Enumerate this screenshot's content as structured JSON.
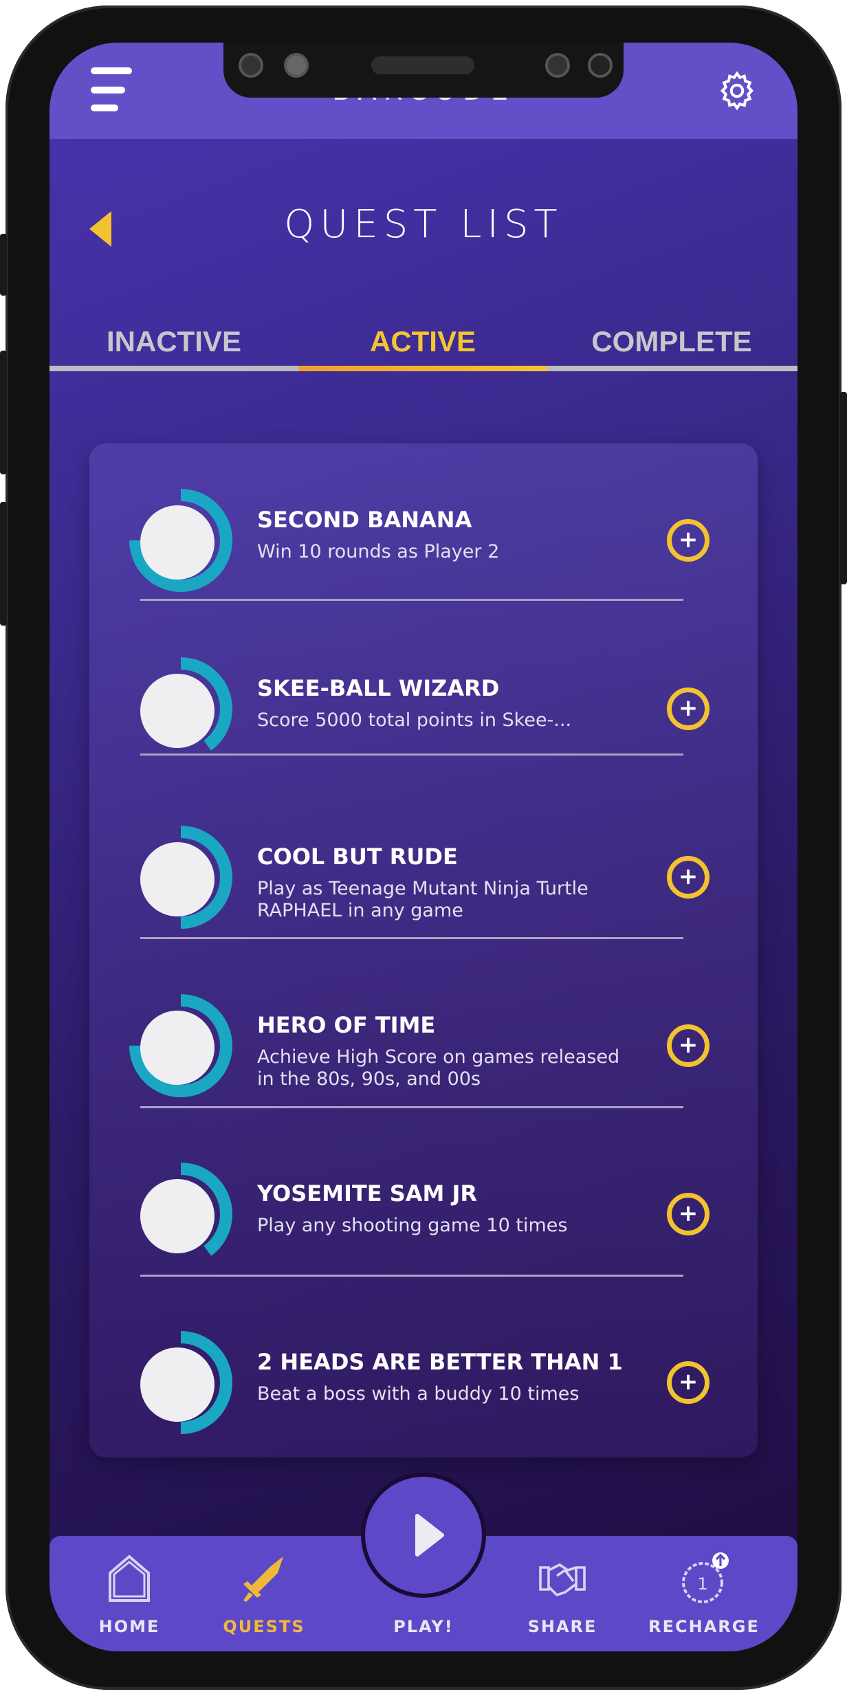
{
  "header": {
    "logo_text": "BARCODE",
    "menu_icon": "hamburger-icon",
    "settings_icon": "gear-icon"
  },
  "page": {
    "title": "QUEST LIST",
    "back_icon": "back-arrow-icon"
  },
  "tabs": [
    {
      "label": "INACTIVE",
      "active": false
    },
    {
      "label": "ACTIVE",
      "active": true
    },
    {
      "label": "COMPLETE",
      "active": false
    }
  ],
  "quests": [
    {
      "title": "SECOND BANANA",
      "description": "Win 10 rounds as Player 2",
      "progress": 0.75
    },
    {
      "title": "SKEE-BALL WIZARD",
      "description": "Score 5000 total points in Skee-...",
      "progress": 0.4
    },
    {
      "title": "COOL BUT RUDE",
      "description": "Play as Teenage Mutant Ninja Turtle RAPHAEL in any game",
      "progress": 0.5
    },
    {
      "title": "HERO OF TIME",
      "description": "Achieve High Score on games released in the 80s, 90s, and 00s",
      "progress": 0.75
    },
    {
      "title": "YOSEMITE SAM JR",
      "description": "Play any shooting game 10 times",
      "progress": 0.4
    },
    {
      "title": "2 HEADS ARE BETTER THAN 1",
      "description": "Beat a boss with a buddy 10 times",
      "progress": 0.5
    }
  ],
  "add_symbol": "+",
  "nav": [
    {
      "label": "HOME",
      "icon": "home-icon",
      "active": false
    },
    {
      "label": "QUESTS",
      "icon": "sword-icon",
      "active": true
    },
    {
      "label": "PLAY!",
      "icon": "play-icon",
      "active": false
    },
    {
      "label": "SHARE",
      "icon": "handshake-icon",
      "active": false
    },
    {
      "label": "RECHARGE",
      "icon": "coin-recharge-icon",
      "active": false
    }
  ],
  "colors": {
    "accent": "#f2c230",
    "ring": "#1aa7c4",
    "header": "#654fc9",
    "nav": "#5d48c8"
  }
}
